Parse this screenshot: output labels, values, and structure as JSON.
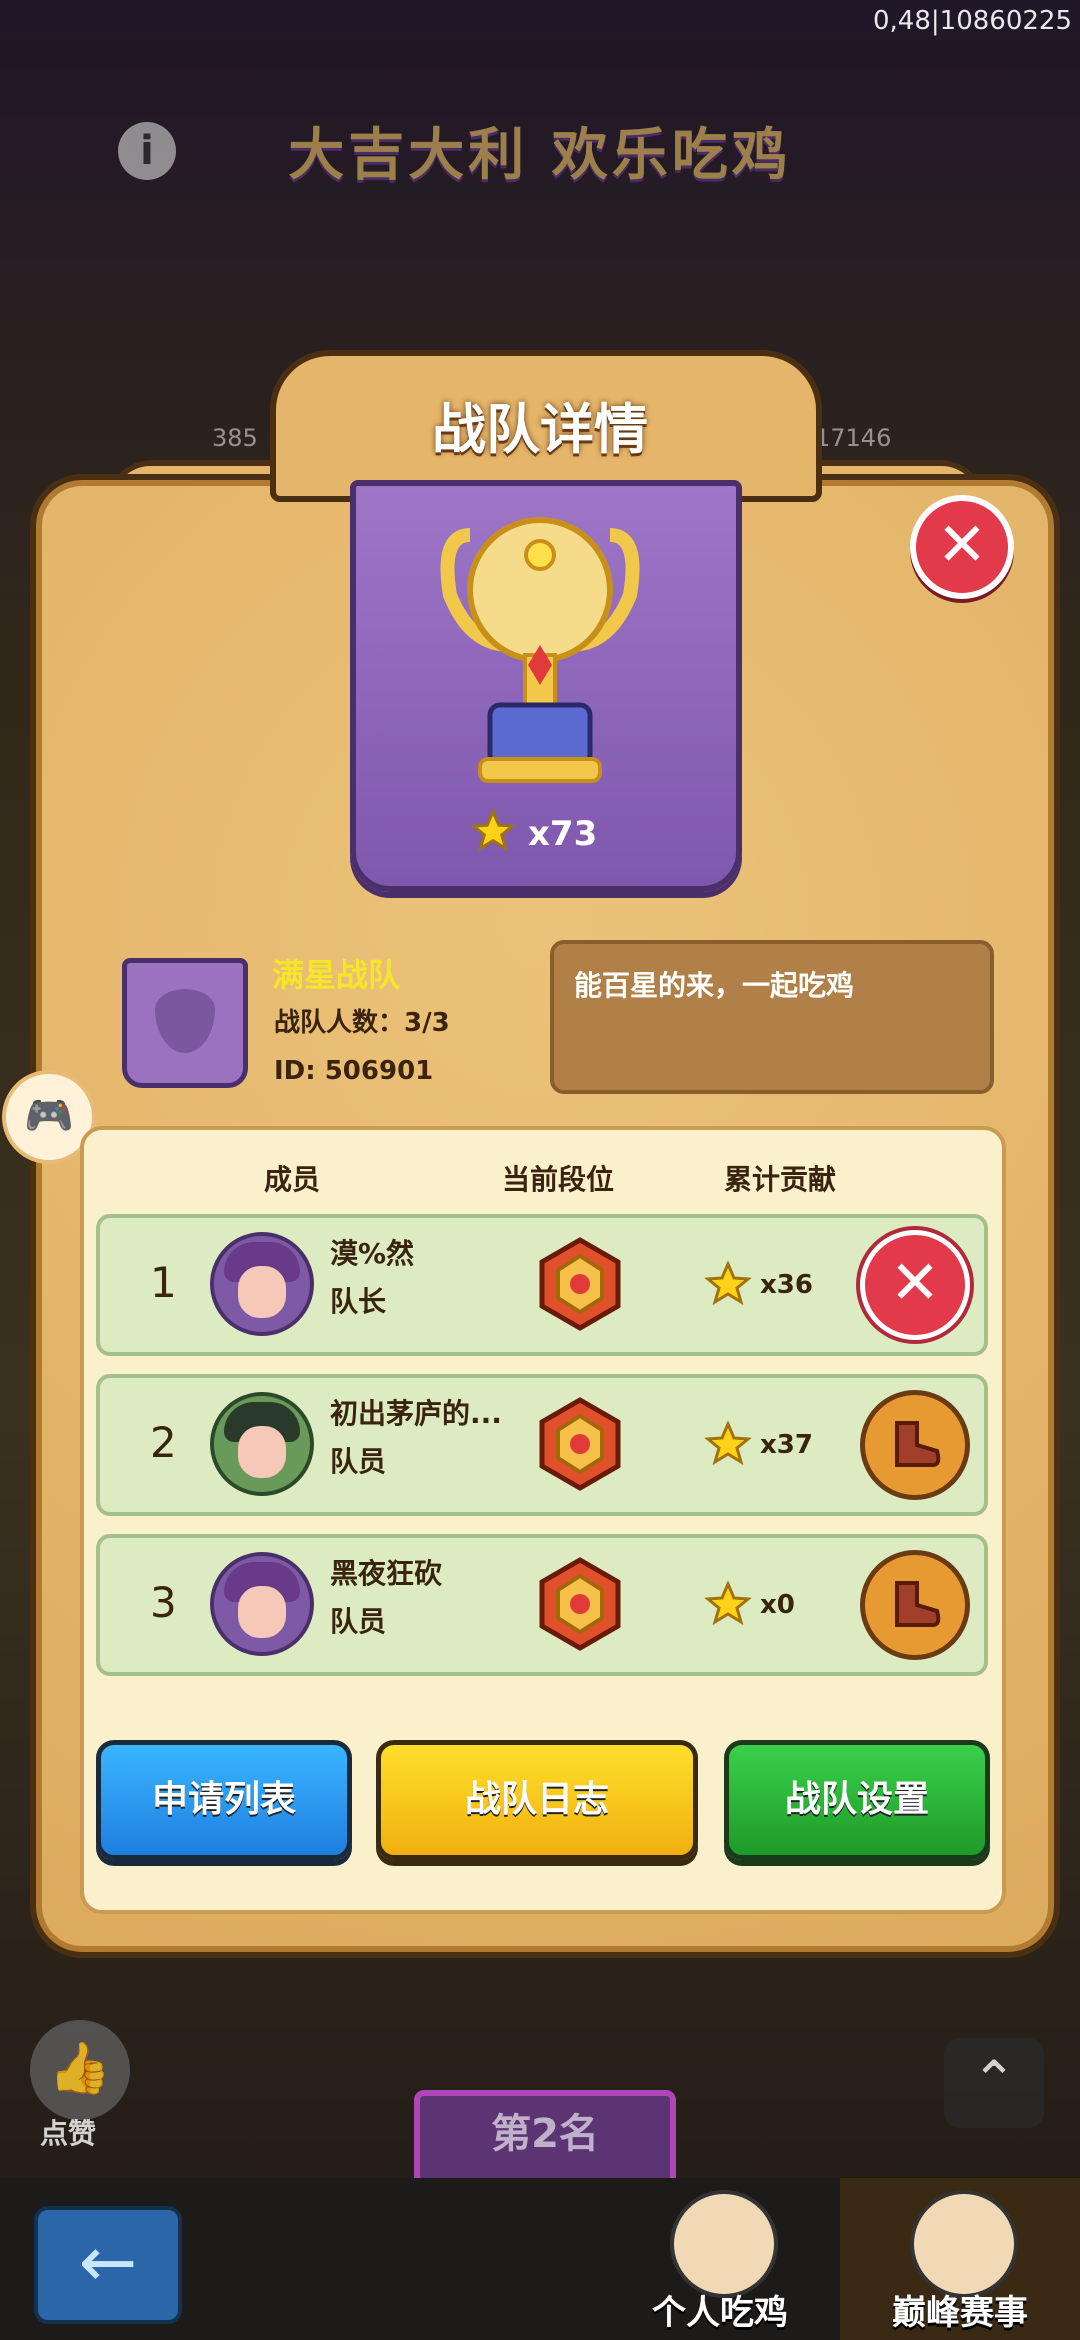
{
  "status": {
    "top_right": "0,48|10860225"
  },
  "background": {
    "banner": "大吉大利 欢乐吃鸡",
    "num_left": "385",
    "num_right": "17146",
    "info_label": "i"
  },
  "panel": {
    "title": "战队详情",
    "close_label": "✕",
    "trophy_count": "x73"
  },
  "team": {
    "name": "满星战队",
    "size_label": "战队人数：",
    "size_value": "3/3",
    "id": "ID: 506901",
    "description": "能百星的来，一起吃鸡"
  },
  "columns": {
    "member": "成员",
    "rank": "当前段位",
    "contribution": "累计贡献"
  },
  "members": [
    {
      "rank": "1",
      "name": "漠%然",
      "role": "队长",
      "contribution": "x36",
      "action": "kick"
    },
    {
      "rank": "2",
      "name": "初出茅庐的...",
      "role": "队员",
      "contribution": "x37",
      "action": "boot"
    },
    {
      "rank": "3",
      "name": "黑夜狂砍",
      "role": "队员",
      "contribution": "x0",
      "action": "boot"
    }
  ],
  "buttons": {
    "apply_list": "申请列表",
    "team_log": "战队日志",
    "team_settings": "战队设置"
  },
  "hud": {
    "like_label": "点赞",
    "rank_plate": "第2名",
    "tab_personal": "个人吃鸡",
    "tab_peak": "巅峰赛事"
  },
  "colors": {
    "panel": "#dcab5e",
    "team_name": "#f6e62a",
    "close_red": "#e23a4a",
    "button_blue": "#1e7ee0",
    "button_yellow": "#f0b010",
    "button_green": "#1e9a2a"
  }
}
